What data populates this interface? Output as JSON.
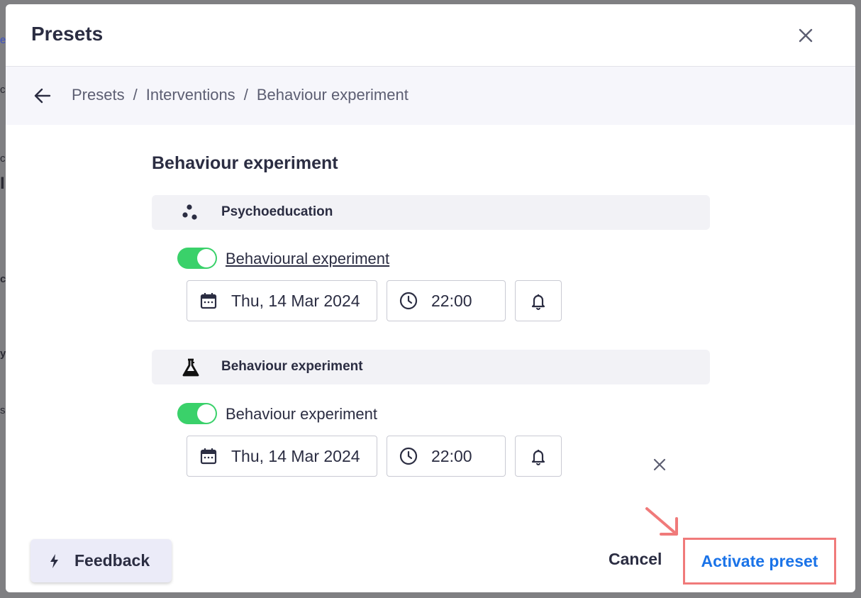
{
  "modal": {
    "title": "Presets"
  },
  "breadcrumb": {
    "items": [
      "Presets",
      "Interventions",
      "Behaviour experiment"
    ],
    "separator": "/"
  },
  "content": {
    "title": "Behaviour experiment",
    "groups": [
      {
        "header": "Psychoeducation",
        "icon": "dots-icon",
        "item_label": "Behavioural experiment",
        "toggle_on": true,
        "date": "Thu, 14 Mar 2024",
        "time": "22:00"
      },
      {
        "header": "Behaviour experiment",
        "icon": "flask-icon",
        "item_label": "Behaviour experiment",
        "toggle_on": true,
        "date": "Thu, 14 Mar 2024",
        "time": "22:00"
      }
    ]
  },
  "footer": {
    "feedback_label": "Feedback",
    "cancel_label": "Cancel",
    "activate_label": "Activate preset"
  },
  "colors": {
    "accent": "#1a73e8",
    "toggle_on": "#3ad16a",
    "highlight": "#f07a7a",
    "text": "#2b2d42"
  }
}
